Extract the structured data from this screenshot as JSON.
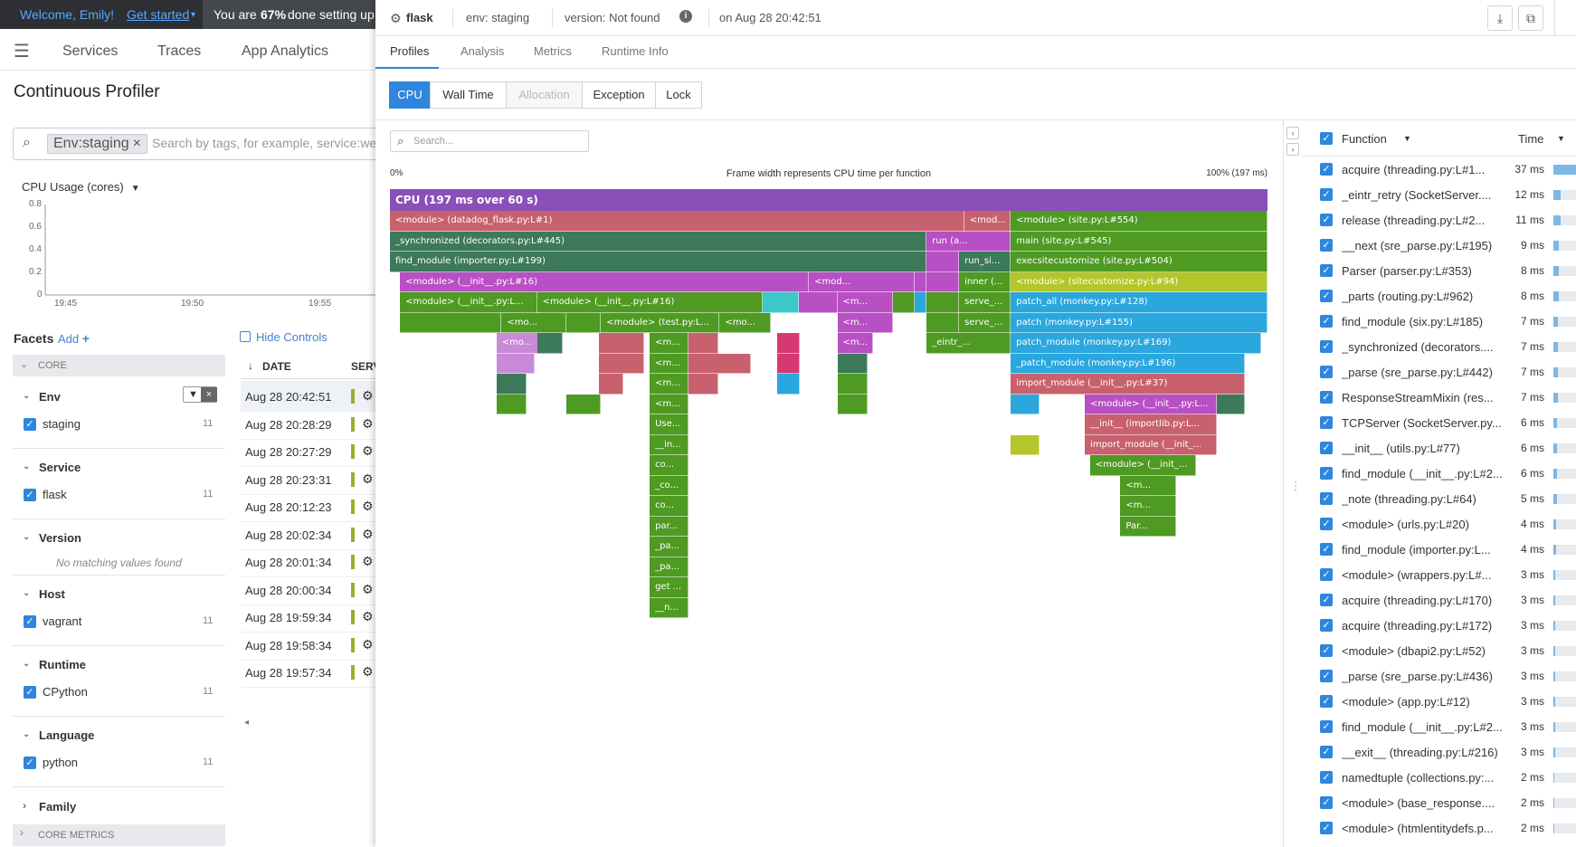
{
  "welcome": {
    "greeting": "Welcome, Emily!",
    "get_started": "Get started",
    "progress_prefix": "You are",
    "progress_pct": "67%",
    "progress_suffix": "done setting up"
  },
  "nav": {
    "items": [
      "Services",
      "Traces",
      "App Analytics"
    ]
  },
  "page_title": "Continuous Profiler",
  "search": {
    "pill": "Env:staging",
    "placeholder": "Search by tags, for example, service:web"
  },
  "cpu_usage": {
    "title": "CPU Usage (cores)",
    "y_ticks": [
      "0.8",
      "0.6",
      "0.4",
      "0.2",
      "0"
    ],
    "x_ticks": [
      "19:45",
      "19:50",
      "19:55"
    ]
  },
  "facets": {
    "title": "Facets",
    "add": "Add",
    "core_label": "CORE",
    "core_metrics_label": "CORE METRICS",
    "groups": [
      {
        "name": "Env",
        "value": "staging",
        "count": "11"
      },
      {
        "name": "Service",
        "value": "flask",
        "count": "11"
      },
      {
        "name": "Version",
        "empty": "No matching values found"
      },
      {
        "name": "Host",
        "value": "vagrant",
        "count": "11"
      },
      {
        "name": "Runtime",
        "value": "CPython",
        "count": "11"
      },
      {
        "name": "Language",
        "value": "python",
        "count": "11"
      },
      {
        "name": "Family"
      }
    ]
  },
  "hide_controls": "Hide Controls",
  "table": {
    "date_header": "DATE",
    "serv_header": "SERV",
    "dates": [
      "Aug 28 20:42:51",
      "Aug 28 20:28:29",
      "Aug 28 20:27:29",
      "Aug 28 20:23:31",
      "Aug 28 20:12:23",
      "Aug 28 20:02:34",
      "Aug 28 20:01:34",
      "Aug 28 20:00:34",
      "Aug 28 19:59:34",
      "Aug 28 19:58:34",
      "Aug 28 19:57:34"
    ]
  },
  "panel": {
    "service": "flask",
    "env": "env: staging",
    "version": "version: Not found",
    "timestamp": "on Aug 28 20:42:51",
    "tabs": [
      "Profiles",
      "Analysis",
      "Metrics",
      "Runtime Info"
    ],
    "modes": [
      "CPU",
      "Wall Time",
      "Allocation",
      "Exception",
      "Lock"
    ],
    "search_placeholder": "Search...",
    "fg_left": "0%",
    "fg_center": "Frame width represents CPU time per function",
    "fg_right": "100% (197 ms)",
    "cpu_root": "CPU (197 ms over 60 s)"
  },
  "colors": {
    "purple": "#8a4fb8",
    "rose": "#c8616e",
    "teal": "#3c7a5a",
    "green": "#4e9a22",
    "magenta": "#b84fc4",
    "blue": "#2aa7de",
    "lime": "#b4c62a",
    "pink": "#d63873",
    "orchid": "#c88ad6",
    "cyan": "#3cc8c8",
    "orange": "#f2a633",
    "accent": "#2e86de"
  },
  "flame": [
    {
      "x": 0,
      "w": 566,
      "l": 0,
      "c": "rose",
      "t": "<module> (datadog_flask.py:L#1)"
    },
    {
      "x": 566,
      "w": 46,
      "l": 0,
      "c": "rose",
      "t": "<mod..."
    },
    {
      "x": 612,
      "w": 253,
      "l": 0,
      "c": "green",
      "t": "<module> (site.py:L#554)"
    },
    {
      "x": 0,
      "w": 529,
      "l": 1,
      "c": "teal",
      "t": "_synchronized (decorators.py:L#445)"
    },
    {
      "x": 529,
      "w": 83,
      "l": 1,
      "c": "magenta",
      "t": "run (a..."
    },
    {
      "x": 612,
      "w": 253,
      "l": 1,
      "c": "green",
      "t": "main (site.py:L#545)"
    },
    {
      "x": 0,
      "w": 529,
      "l": 2,
      "c": "teal",
      "t": "find_module (importer.py:L#199)"
    },
    {
      "x": 529,
      "w": 32,
      "l": 2,
      "c": "magenta",
      "t": ""
    },
    {
      "x": 561,
      "w": 51,
      "l": 2,
      "c": "teal",
      "t": "run_si..."
    },
    {
      "x": 612,
      "w": 253,
      "l": 2,
      "c": "green",
      "t": "execsitecustomize (site.py:L#504)"
    },
    {
      "x": 10,
      "w": 403,
      "l": 3,
      "c": "magenta",
      "t": "<module> (__init__.py:L#16)"
    },
    {
      "x": 413,
      "w": 104,
      "l": 3,
      "c": "magenta",
      "t": "<mod..."
    },
    {
      "x": 517,
      "w": 12,
      "l": 3,
      "c": "magenta",
      "t": ""
    },
    {
      "x": 529,
      "w": 32,
      "l": 3,
      "c": "magenta",
      "t": ""
    },
    {
      "x": 561,
      "w": 51,
      "l": 3,
      "c": "green",
      "t": "inner (..."
    },
    {
      "x": 612,
      "w": 253,
      "l": 3,
      "c": "lime",
      "t": "<module> (sitecustomize.py:L#94)"
    },
    {
      "x": 10,
      "w": 135,
      "l": 4,
      "c": "green",
      "t": "<module> (__init__.py:L..."
    },
    {
      "x": 145,
      "w": 222,
      "l": 4,
      "c": "green",
      "t": "<module> (__init__.py:L#16)"
    },
    {
      "x": 367,
      "w": 36,
      "l": 4,
      "c": "cyan",
      "t": ""
    },
    {
      "x": 403,
      "w": 38,
      "l": 4,
      "c": "magenta",
      "t": ""
    },
    {
      "x": 441,
      "w": 55,
      "l": 4,
      "c": "magenta",
      "t": "<m..."
    },
    {
      "x": 496,
      "w": 21,
      "l": 4,
      "c": "green",
      "t": ""
    },
    {
      "x": 517,
      "w": 12,
      "l": 4,
      "c": "blue",
      "t": ""
    },
    {
      "x": 529,
      "w": 32,
      "l": 4,
      "c": "green",
      "t": ""
    },
    {
      "x": 561,
      "w": 51,
      "l": 4,
      "c": "green",
      "t": "serve_..."
    },
    {
      "x": 612,
      "w": 253,
      "l": 4,
      "c": "blue",
      "t": "patch_all (monkey.py:L#128)"
    },
    {
      "x": 10,
      "w": 100,
      "l": 5,
      "c": "green",
      "t": ""
    },
    {
      "x": 110,
      "w": 64,
      "l": 5,
      "c": "green",
      "t": "<mo..."
    },
    {
      "x": 174,
      "w": 34,
      "l": 5,
      "c": "green",
      "t": ""
    },
    {
      "x": 208,
      "w": 117,
      "l": 5,
      "c": "green",
      "t": "<module> (test.py:L..."
    },
    {
      "x": 325,
      "w": 50,
      "l": 5,
      "c": "green",
      "t": "<mo..."
    },
    {
      "x": 441,
      "w": 55,
      "l": 5,
      "c": "magenta",
      "t": "<m..."
    },
    {
      "x": 529,
      "w": 32,
      "l": 5,
      "c": "green",
      "t": ""
    },
    {
      "x": 561,
      "w": 51,
      "l": 5,
      "c": "green",
      "t": "serve_..."
    },
    {
      "x": 612,
      "w": 253,
      "l": 5,
      "c": "blue",
      "t": "patch (monkey.py:L#155)"
    },
    {
      "x": 105,
      "w": 64,
      "l": 6,
      "c": "orchid",
      "t": "<mo..."
    },
    {
      "x": 145,
      "w": 25,
      "l": 6,
      "c": "teal",
      "t": ""
    },
    {
      "x": 206,
      "w": 45,
      "l": 6,
      "c": "rose",
      "t": ""
    },
    {
      "x": 256,
      "w": 38,
      "l": 6,
      "c": "green",
      "t": "<m..."
    },
    {
      "x": 294,
      "w": 30,
      "l": 6,
      "c": "rose",
      "t": ""
    },
    {
      "x": 382,
      "w": 22,
      "l": 6,
      "c": "pink",
      "t": ""
    },
    {
      "x": 441,
      "w": 35,
      "l": 6,
      "c": "magenta",
      "t": "<m..."
    },
    {
      "x": 529,
      "w": 83,
      "l": 6,
      "c": "green",
      "t": "_eintr_..."
    },
    {
      "x": 612,
      "w": 247,
      "l": 6,
      "c": "blue",
      "t": "patch_module (monkey.py:L#169)"
    },
    {
      "x": 105,
      "w": 38,
      "l": 7,
      "c": "orchid",
      "t": ""
    },
    {
      "x": 206,
      "w": 45,
      "l": 7,
      "c": "rose",
      "t": ""
    },
    {
      "x": 256,
      "w": 38,
      "l": 7,
      "c": "green",
      "t": "<m..."
    },
    {
      "x": 294,
      "w": 62,
      "l": 7,
      "c": "rose",
      "t": ""
    },
    {
      "x": 382,
      "w": 22,
      "l": 7,
      "c": "pink",
      "t": ""
    },
    {
      "x": 441,
      "w": 30,
      "l": 7,
      "c": "teal",
      "t": ""
    },
    {
      "x": 612,
      "w": 231,
      "l": 7,
      "c": "blue",
      "t": "_patch_module (monkey.py:L#196)"
    },
    {
      "x": 105,
      "w": 30,
      "l": 8,
      "c": "teal",
      "t": ""
    },
    {
      "x": 206,
      "w": 24,
      "l": 8,
      "c": "rose",
      "t": ""
    },
    {
      "x": 256,
      "w": 38,
      "l": 8,
      "c": "green",
      "t": "<m..."
    },
    {
      "x": 294,
      "w": 30,
      "l": 8,
      "c": "rose",
      "t": ""
    },
    {
      "x": 382,
      "w": 22,
      "l": 8,
      "c": "blue",
      "t": ""
    },
    {
      "x": 441,
      "w": 30,
      "l": 8,
      "c": "green",
      "t": ""
    },
    {
      "x": 612,
      "w": 231,
      "l": 8,
      "c": "rose",
      "t": "import_module (__init__.py:L#37)"
    },
    {
      "x": 105,
      "w": 30,
      "l": 9,
      "c": "green",
      "t": ""
    },
    {
      "x": 174,
      "w": 34,
      "l": 9,
      "c": "green",
      "t": ""
    },
    {
      "x": 256,
      "w": 38,
      "l": 9,
      "c": "green",
      "t": "<m..."
    },
    {
      "x": 441,
      "w": 30,
      "l": 9,
      "c": "green",
      "t": ""
    },
    {
      "x": 612,
      "w": 28,
      "l": 9,
      "c": "blue",
      "t": ""
    },
    {
      "x": 685,
      "w": 130,
      "l": 9,
      "c": "magenta",
      "t": "<module> (__init__.py:L..."
    },
    {
      "x": 815,
      "w": 28,
      "l": 9,
      "c": "teal",
      "t": ""
    },
    {
      "x": 256,
      "w": 38,
      "l": 10,
      "c": "green",
      "t": "Use..."
    },
    {
      "x": 685,
      "w": 130,
      "l": 10,
      "c": "rose",
      "t": "__init__ (importlib.py:L..."
    },
    {
      "x": 612,
      "w": 28,
      "l": 11,
      "c": "lime",
      "t": ""
    },
    {
      "x": 685,
      "w": 130,
      "l": 11,
      "c": "rose",
      "t": "import_module (__init_..."
    },
    {
      "x": 256,
      "w": 38,
      "l": 11,
      "c": "green",
      "t": "__in..."
    },
    {
      "x": 256,
      "w": 38,
      "l": 12,
      "c": "green",
      "t": "co..."
    },
    {
      "x": 690,
      "w": 105,
      "l": 12,
      "c": "green",
      "t": "<module> (__init_..."
    },
    {
      "x": 256,
      "w": 38,
      "l": 13,
      "c": "green",
      "t": "_co..."
    },
    {
      "x": 720,
      "w": 55,
      "l": 13,
      "c": "green",
      "t": "<m..."
    },
    {
      "x": 256,
      "w": 38,
      "l": 14,
      "c": "green",
      "t": "co..."
    },
    {
      "x": 720,
      "w": 55,
      "l": 14,
      "c": "green",
      "t": "<m..."
    },
    {
      "x": 256,
      "w": 38,
      "l": 15,
      "c": "green",
      "t": "par..."
    },
    {
      "x": 720,
      "w": 55,
      "l": 15,
      "c": "green",
      "t": "Par..."
    },
    {
      "x": 256,
      "w": 38,
      "l": 16,
      "c": "green",
      "t": "_pa..."
    },
    {
      "x": 256,
      "w": 38,
      "l": 17,
      "c": "green",
      "t": "_pa..."
    },
    {
      "x": 256,
      "w": 38,
      "l": 18,
      "c": "green",
      "t": "get ..."
    },
    {
      "x": 256,
      "w": 38,
      "l": 19,
      "c": "green",
      "t": "__n..."
    }
  ],
  "functions": {
    "header_function": "Function",
    "header_time": "Time",
    "rows": [
      {
        "name": "acquire (threading.py:L#1...",
        "time": "37 ms",
        "frac": 1.0
      },
      {
        "name": "_eintr_retry (SocketServer....",
        "time": "12 ms",
        "frac": 0.32
      },
      {
        "name": "release (threading.py:L#2...",
        "time": "11 ms",
        "frac": 0.3
      },
      {
        "name": "__next (sre_parse.py:L#195)",
        "time": "9 ms",
        "frac": 0.24
      },
      {
        "name": "Parser (parser.py:L#353)",
        "time": "8 ms",
        "frac": 0.22
      },
      {
        "name": "_parts (routing.py:L#962)",
        "time": "8 ms",
        "frac": 0.22
      },
      {
        "name": "find_module (six.py:L#185)",
        "time": "7 ms",
        "frac": 0.19
      },
      {
        "name": "_synchronized (decorators....",
        "time": "7 ms",
        "frac": 0.19
      },
      {
        "name": "_parse (sre_parse.py:L#442)",
        "time": "7 ms",
        "frac": 0.19
      },
      {
        "name": "ResponseStreamMixin (res...",
        "time": "7 ms",
        "frac": 0.19
      },
      {
        "name": "TCPServer (SocketServer.py...",
        "time": "6 ms",
        "frac": 0.16
      },
      {
        "name": "__init__ (utils.py:L#77)",
        "time": "6 ms",
        "frac": 0.16
      },
      {
        "name": "find_module (__init__.py:L#2...",
        "time": "6 ms",
        "frac": 0.16
      },
      {
        "name": "_note (threading.py:L#64)",
        "time": "5 ms",
        "frac": 0.14
      },
      {
        "name": "<module> (urls.py:L#20)",
        "time": "4 ms",
        "frac": 0.11
      },
      {
        "name": "find_module (importer.py:L...",
        "time": "4 ms",
        "frac": 0.11
      },
      {
        "name": "<module> (wrappers.py:L#...",
        "time": "3 ms",
        "frac": 0.08
      },
      {
        "name": "acquire (threading.py:L#170)",
        "time": "3 ms",
        "frac": 0.08
      },
      {
        "name": "acquire (threading.py:L#172)",
        "time": "3 ms",
        "frac": 0.08
      },
      {
        "name": "<module> (dbapi2.py:L#52)",
        "time": "3 ms",
        "frac": 0.08
      },
      {
        "name": "_parse (sre_parse.py:L#436)",
        "time": "3 ms",
        "frac": 0.08
      },
      {
        "name": "<module> (app.py:L#12)",
        "time": "3 ms",
        "frac": 0.08
      },
      {
        "name": "find_module (__init__.py:L#2...",
        "time": "3 ms",
        "frac": 0.08
      },
      {
        "name": "__exit__ (threading.py:L#216)",
        "time": "3 ms",
        "frac": 0.08
      },
      {
        "name": "namedtuple (collections.py:...",
        "time": "2 ms",
        "frac": 0.05
      },
      {
        "name": "<module> (base_response....",
        "time": "2 ms",
        "frac": 0.05
      },
      {
        "name": "<module> (htmlentitydefs.p...",
        "time": "2 ms",
        "frac": 0.05
      }
    ]
  }
}
